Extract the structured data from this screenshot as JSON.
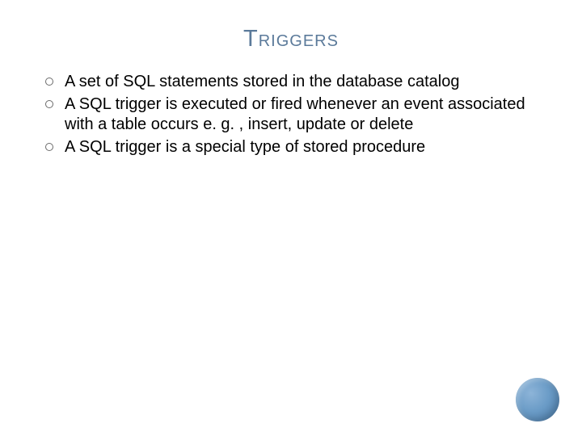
{
  "slide": {
    "title": "Triggers",
    "bullets": [
      "A set of  SQL statements stored in the database catalog",
      " A SQL trigger is executed or fired whenever an event associated with a table occurs e. g. ,  insert, update or delete",
      "A SQL trigger is a special type of stored procedure"
    ]
  }
}
